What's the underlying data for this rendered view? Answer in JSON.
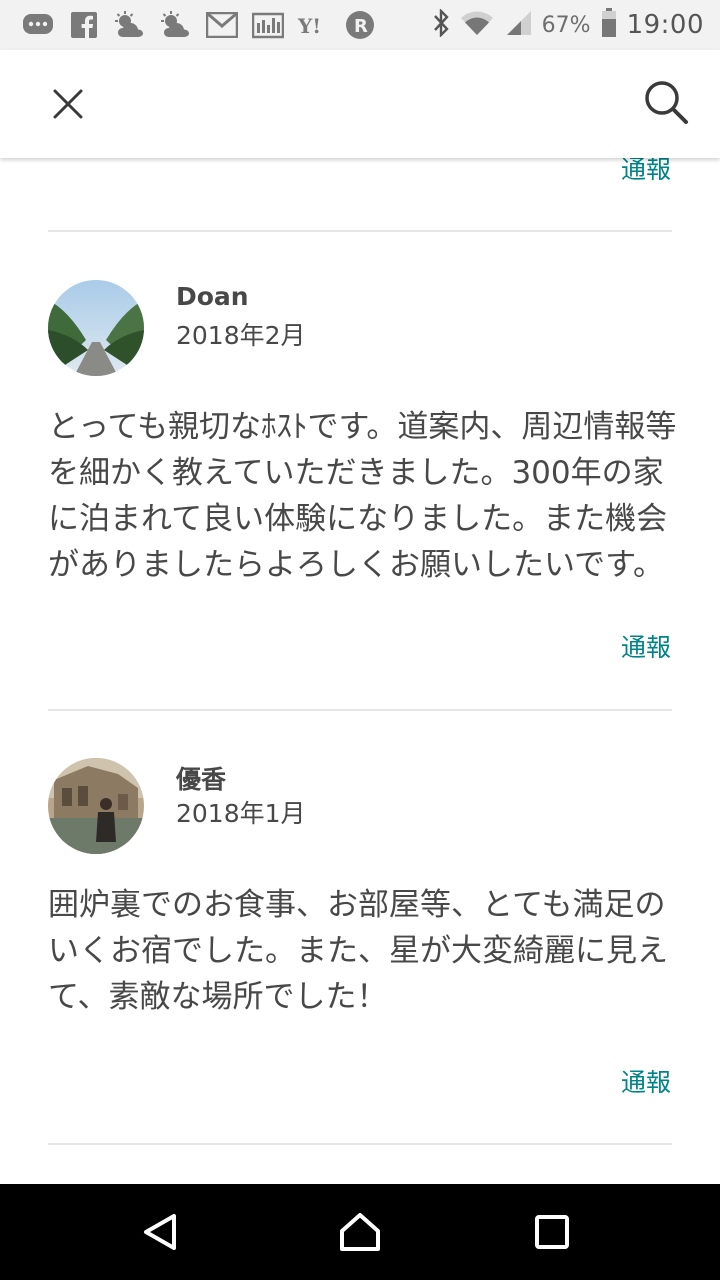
{
  "status_bar": {
    "battery_percent": "67%",
    "time": "19:00",
    "notification_icons": [
      "chat-icon",
      "facebook-icon",
      "weather-icon",
      "weather-icon",
      "gmail-icon",
      "news-icon",
      "yahoo-icon",
      "rakuten-icon"
    ]
  },
  "app_bar": {
    "close_icon": "close-icon",
    "search_icon": "search-icon"
  },
  "reviews": {
    "previous_report_label": "通報",
    "items": [
      {
        "name": "Doan",
        "date": "2018年2月",
        "text": "とっても親切なﾎｽﾄです。道案内、周辺情報等\nを細かく教えていただきました。300年の家\nに泊まれて良い体験になりました。また機会\nがありましたらよろしくお願いしたいです。",
        "report_label": "通報"
      },
      {
        "name": "優香",
        "date": "2018年1月",
        "text": "囲炉裏でのお食事、お部屋等、とても満足の\nいくお宿でした。また、星が大変綺麗に見え\nて、素敵な場所でした！",
        "report_label": "通報"
      }
    ]
  },
  "colors": {
    "accent": "#008489",
    "text": "#484848",
    "divider": "#e6e6e6"
  }
}
